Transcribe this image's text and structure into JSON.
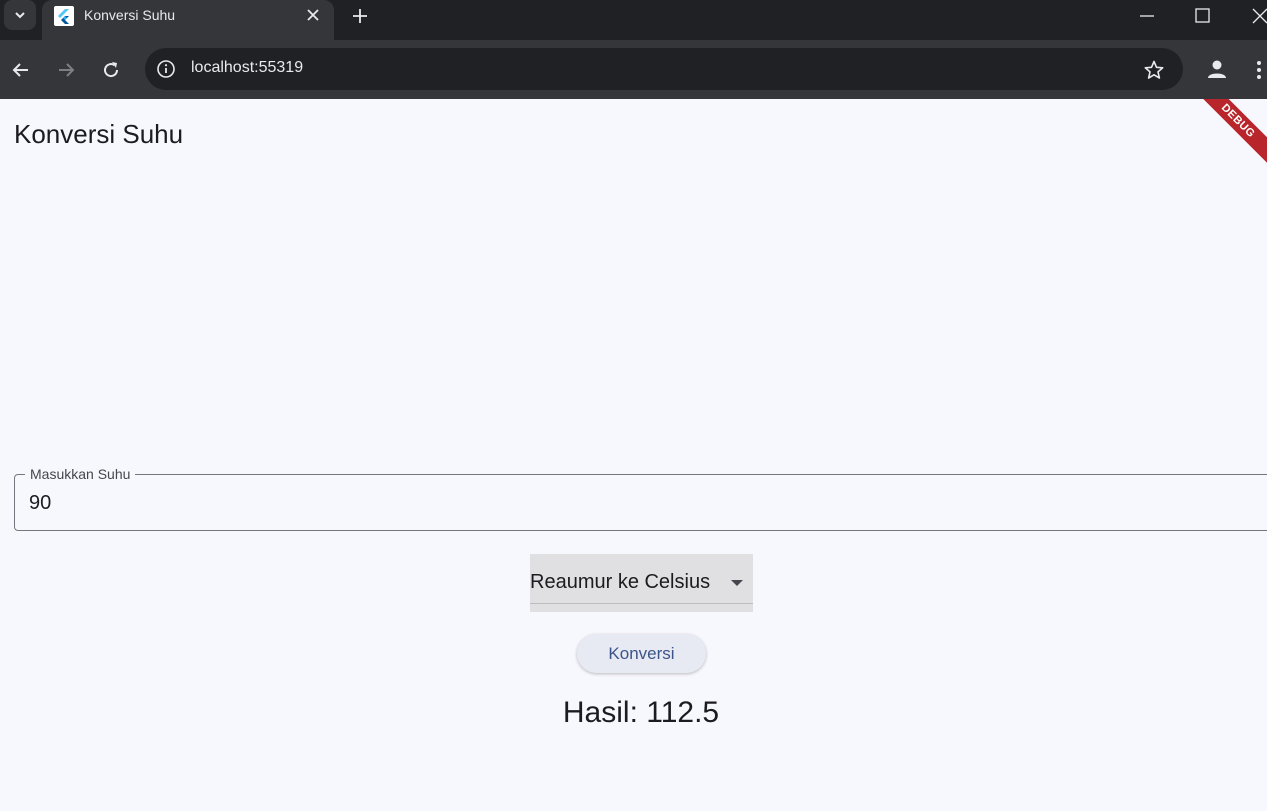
{
  "browser": {
    "tab_title": "Konversi Suhu",
    "url": "localhost:55319"
  },
  "app": {
    "title": "Konversi Suhu",
    "debug_banner": "DEBUG"
  },
  "form": {
    "input_label": "Masukkan Suhu",
    "input_value": "90",
    "dropdown_value": "Reaumur ke Celsius",
    "button_label": "Konversi",
    "result_text": "Hasil: 112.5"
  },
  "colors": {
    "page_background": "#f7f8fd",
    "button_text": "#3b5588",
    "debug_banner": "#b8262c"
  }
}
